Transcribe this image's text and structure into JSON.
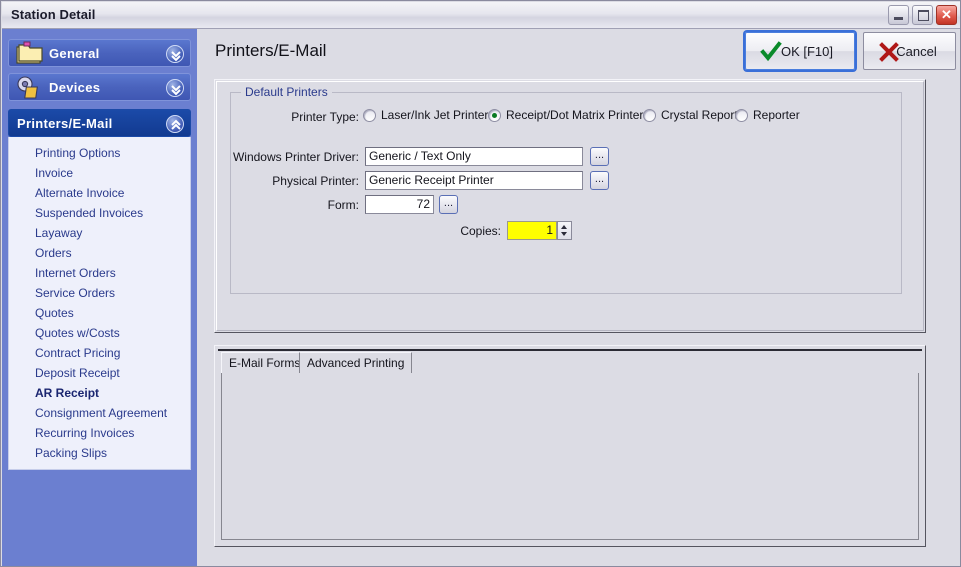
{
  "window": {
    "title": "Station Detail",
    "buttons": {
      "minimize": "minimize",
      "maximize": "maximize",
      "close": "✕"
    }
  },
  "sidebar": {
    "sections": [
      {
        "label": "General",
        "icon": "folder-icon",
        "state": "collapsed",
        "chevron": "chevron-down-icon"
      },
      {
        "label": "Devices",
        "icon": "gears-icon",
        "state": "collapsed",
        "chevron": "chevron-down-icon"
      },
      {
        "label": "Printers/E-Mail",
        "icon": "none",
        "state": "expanded",
        "chevron": "chevron-up-icon"
      }
    ],
    "items": [
      {
        "label": "Printing Options",
        "selected": false
      },
      {
        "label": "Invoice",
        "selected": false
      },
      {
        "label": "Alternate Invoice",
        "selected": false
      },
      {
        "label": "Suspended Invoices",
        "selected": false
      },
      {
        "label": "Layaway",
        "selected": false
      },
      {
        "label": "Orders",
        "selected": false
      },
      {
        "label": "Internet Orders",
        "selected": false
      },
      {
        "label": "Service Orders",
        "selected": false
      },
      {
        "label": "Quotes",
        "selected": false
      },
      {
        "label": "Quotes w/Costs",
        "selected": false
      },
      {
        "label": "Contract Pricing",
        "selected": false
      },
      {
        "label": "Deposit Receipt",
        "selected": false
      },
      {
        "label": "AR Receipt",
        "selected": true
      },
      {
        "label": "Consignment Agreement",
        "selected": false
      },
      {
        "label": "Recurring Invoices",
        "selected": false
      },
      {
        "label": "Packing Slips",
        "selected": false
      }
    ]
  },
  "header": {
    "page_title": "Printers/E-Mail",
    "ok_label": "OK [F10]",
    "cancel_label": "Cancel",
    "ok_icon": "check-icon",
    "cancel_icon": "x-icon"
  },
  "default_printers": {
    "group_title": "Default Printers",
    "printer_type": {
      "label": "Printer Type:",
      "options": [
        {
          "label": "Laser/Ink Jet Printer",
          "checked": false
        },
        {
          "label": "Receipt/Dot Matrix Printer",
          "checked": true
        },
        {
          "label": "Crystal Report",
          "checked": false
        },
        {
          "label": "Reporter",
          "checked": false
        }
      ]
    },
    "fields": [
      {
        "label": "Windows Printer Driver:",
        "value": "Generic / Text Only",
        "browse": "..."
      },
      {
        "label": "Physical Printer:",
        "value": "Generic Receipt Printer",
        "browse": "..."
      },
      {
        "label": "Form:",
        "value": "72",
        "browse": "..."
      }
    ],
    "copies": {
      "label": "Copies:",
      "value": "1",
      "highlight_color": "#ffff00",
      "spinner": "spinner-updown"
    }
  },
  "tabs": {
    "items": [
      {
        "label": "E-Mail Forms",
        "active": true
      },
      {
        "label": "Advanced Printing",
        "active": false
      }
    ]
  },
  "colors": {
    "sidebar_bg": "#6b7fd0",
    "sidebar_header_active": "#123a90",
    "list_bg": "#eef0fb",
    "list_text": "#2a3a8c",
    "dialog_bg": "#dcdce4",
    "group_title": "#2a3a8c",
    "radio_dot": "#0a7a22",
    "check_icon": "#0a8a2a",
    "x_icon": "#b01818"
  }
}
